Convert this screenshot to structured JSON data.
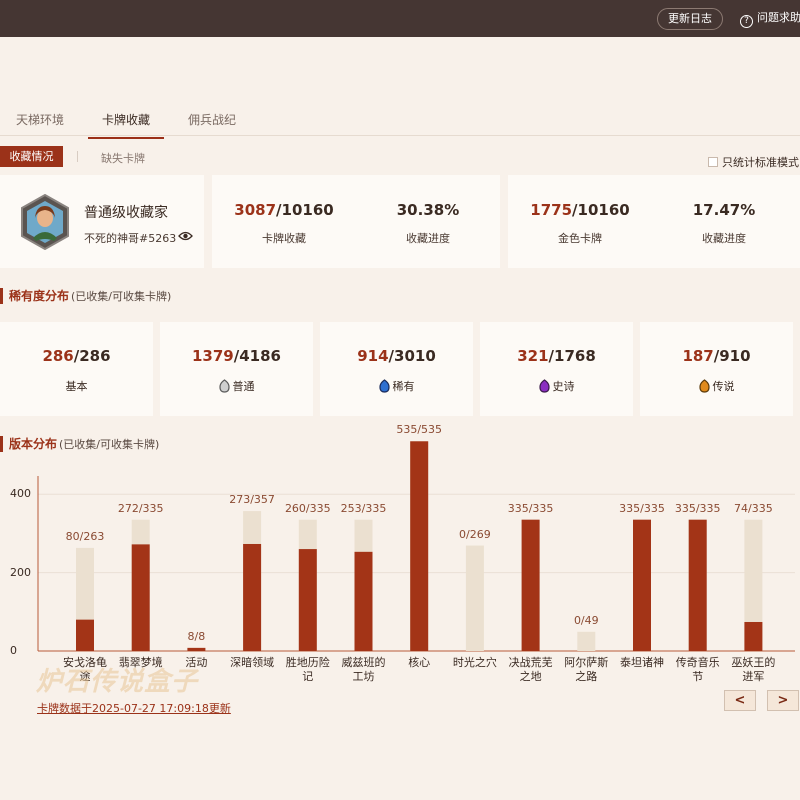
{
  "topbar": {
    "changelog": "更新日志",
    "help": "问题求助",
    "help_icon": "question-circle-icon"
  },
  "tabs": [
    {
      "label": "天梯环境",
      "active": false
    },
    {
      "label": "卡牌收藏",
      "active": true
    },
    {
      "label": "佣兵战纪",
      "active": false
    }
  ],
  "subtabs": {
    "active": "收藏情况",
    "other": "缺失卡牌"
  },
  "standard_only": {
    "label": "只统计标准模式",
    "checked": false
  },
  "profile": {
    "title": "普通级收藏家",
    "name": "不死的神哥#5263",
    "icon": "eye-icon"
  },
  "stats": {
    "cards_owned": "3087",
    "cards_total": "/10160",
    "cards_label": "卡牌收藏",
    "cards_pct": "30.38%",
    "cards_pct_label": "收藏进度",
    "golden_owned": "1775",
    "golden_total": "/10160",
    "golden_label": "金色卡牌",
    "golden_pct": "17.47%",
    "golden_pct_label": "收藏进度"
  },
  "rarity_section": {
    "title": "稀有度分布",
    "note": "(已收集/可收集卡牌)"
  },
  "rarity": [
    {
      "owned": "286",
      "total": "/286",
      "label": "基本",
      "color": ""
    },
    {
      "owned": "1379",
      "total": "/4186",
      "label": "普通",
      "color": "#9a9a9a"
    },
    {
      "owned": "914",
      "total": "/3010",
      "label": "稀有",
      "color": "#2e6fd0"
    },
    {
      "owned": "321",
      "total": "/1768",
      "label": "史诗",
      "color": "#8a2ec0"
    },
    {
      "owned": "187",
      "total": "/910",
      "label": "传说",
      "color": "#e08a1c"
    }
  ],
  "version_section": {
    "title": "版本分布",
    "note": "(已收集/可收集卡牌)"
  },
  "chart_data": {
    "type": "bar",
    "ylim": [
      0,
      450
    ],
    "yticks": [
      0,
      200,
      400
    ],
    "colors": {
      "owned": "#a33417",
      "total": "#ebe0d0"
    },
    "categories": [
      {
        "name": "安戈洛龟途",
        "lines": [
          "安戈洛龟",
          "途"
        ],
        "owned": 80,
        "total": 263,
        "label": "80/263"
      },
      {
        "name": "翡翠梦境",
        "lines": [
          "翡翠梦境"
        ],
        "owned": 272,
        "total": 335,
        "label": "272/335"
      },
      {
        "name": "活动",
        "lines": [
          "活动"
        ],
        "owned": 8,
        "total": 8,
        "label": "8/8"
      },
      {
        "name": "深暗领域",
        "lines": [
          "深暗领域"
        ],
        "owned": 273,
        "total": 357,
        "label": "273/357"
      },
      {
        "name": "胜地历险记",
        "lines": [
          "胜地历险",
          "记"
        ],
        "owned": 260,
        "total": 335,
        "label": "260/335"
      },
      {
        "name": "威兹班的工坊",
        "lines": [
          "威兹班的",
          "工坊"
        ],
        "owned": 253,
        "total": 335,
        "label": "253/335"
      },
      {
        "name": "核心",
        "lines": [
          "核心"
        ],
        "owned": 535,
        "total": 535,
        "label": "535/535"
      },
      {
        "name": "时光之穴",
        "lines": [
          "时光之穴"
        ],
        "owned": 0,
        "total": 269,
        "label": "0/269"
      },
      {
        "name": "决战荒芜之地",
        "lines": [
          "决战荒芜",
          "之地"
        ],
        "owned": 335,
        "total": 335,
        "label": "335/335"
      },
      {
        "name": "阿尔萨斯之路",
        "lines": [
          "阿尔萨斯",
          "之路"
        ],
        "owned": 0,
        "total": 49,
        "label": "0/49"
      },
      {
        "name": "泰坦诸神",
        "lines": [
          "泰坦诸神"
        ],
        "owned": 335,
        "total": 335,
        "label": "335/335"
      },
      {
        "name": "传奇音乐节",
        "lines": [
          "传奇音乐",
          "节"
        ],
        "owned": 335,
        "total": 335,
        "label": "335/335"
      },
      {
        "name": "巫妖王的进军",
        "lines": [
          "巫妖王的",
          "进军"
        ],
        "owned": 74,
        "total": 335,
        "label": "74/335"
      }
    ]
  },
  "watermark": "炉石传说盒子",
  "update_text": "卡牌数据于2025-07-27 17:09:18更新",
  "nav": {
    "prev": "<",
    "next": ">"
  }
}
